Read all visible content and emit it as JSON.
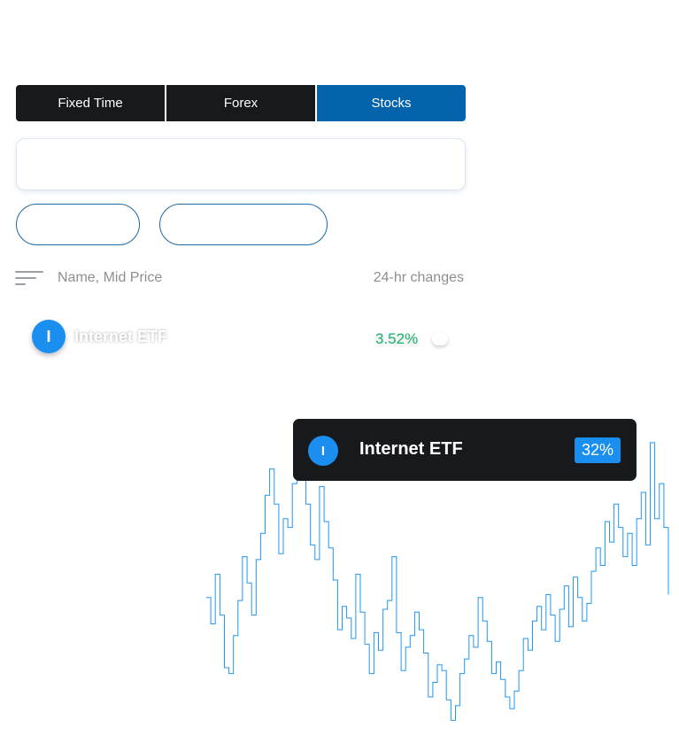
{
  "tabs": [
    {
      "label": "Fixed Time",
      "active": false
    },
    {
      "label": "Forex",
      "active": false
    },
    {
      "label": "Stocks",
      "active": true
    }
  ],
  "search": {
    "placeholder": ""
  },
  "list_header": {
    "name_col": "Name, Mid Price",
    "change_col": "24-hr changes"
  },
  "assets": [
    {
      "initial": "I",
      "name": "Internet ETF",
      "change": "3.52%"
    }
  ],
  "tooltip": {
    "initial": "I",
    "name": "Internet ETF",
    "badge": "32%"
  },
  "sparkline": {
    "color": "#2196f3",
    "values": [
      0.44,
      0.35,
      0.52,
      0.38,
      0.2,
      0.18,
      0.31,
      0.43,
      0.58,
      0.49,
      0.38,
      0.57,
      0.66,
      0.79,
      0.88,
      0.76,
      0.59,
      0.71,
      0.68,
      0.83,
      0.9,
      0.93,
      0.76,
      0.62,
      0.57,
      0.82,
      0.7,
      0.61,
      0.5,
      0.33,
      0.41,
      0.37,
      0.3,
      0.52,
      0.39,
      0.28,
      0.18,
      0.32,
      0.26,
      0.4,
      0.43,
      0.58,
      0.32,
      0.19,
      0.27,
      0.31,
      0.39,
      0.33,
      0.25,
      0.1,
      0.15,
      0.21,
      0.19,
      0.09,
      0.02,
      0.07,
      0.18,
      0.23,
      0.31,
      0.27,
      0.44,
      0.36,
      0.29,
      0.18,
      0.22,
      0.16,
      0.1,
      0.06,
      0.12,
      0.19,
      0.3,
      0.26,
      0.36,
      0.41,
      0.33,
      0.45,
      0.38,
      0.29,
      0.4,
      0.48,
      0.34,
      0.51,
      0.44,
      0.36,
      0.42,
      0.53,
      0.61,
      0.55,
      0.7,
      0.63,
      0.76,
      0.68,
      0.58,
      0.66,
      0.55,
      0.71,
      0.8,
      0.62,
      0.97,
      0.71,
      0.83,
      0.68,
      0.45
    ]
  }
}
